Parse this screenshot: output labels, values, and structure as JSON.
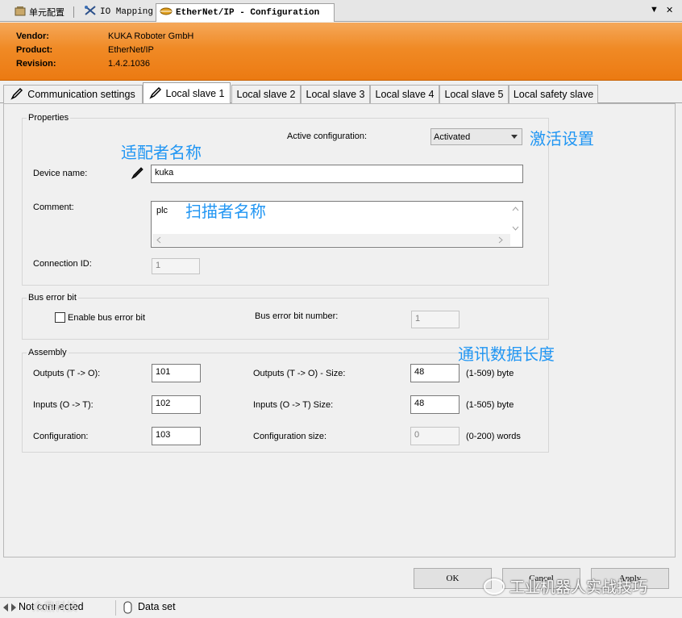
{
  "doc_tabs": [
    {
      "label": "单元配置",
      "icon": "device-config-icon"
    },
    {
      "label": "IO Mapping",
      "icon": "io-mapping-icon"
    },
    {
      "label": "EtherNet/IP - Configuration",
      "icon": "ethernet-ip-icon",
      "active": true
    }
  ],
  "doc_tab_controls": {
    "dropdown": "▼",
    "close": "✕"
  },
  "header": {
    "vendor_label": "Vendor:",
    "vendor_value": "KUKA Roboter GmbH",
    "product_label": "Product:",
    "product_value": "EtherNet/IP",
    "revision_label": "Revision:",
    "revision_value": "1.4.2.1036",
    "color": "#f08a25"
  },
  "sub_tabs": [
    {
      "label": "Communication settings",
      "icon": "pencil-icon"
    },
    {
      "label": "Local slave 1",
      "icon": "pencil-icon",
      "active": true
    },
    {
      "label": "Local slave 2"
    },
    {
      "label": "Local slave 3"
    },
    {
      "label": "Local slave 4"
    },
    {
      "label": "Local slave 5"
    },
    {
      "label": "Local safety slave"
    }
  ],
  "properties": {
    "title": "Properties",
    "active_config_label": "Active configuration:",
    "active_config_value": "Activated",
    "device_name_label": "Device name:",
    "device_name_value": "kuka",
    "comment_label": "Comment:",
    "comment_value": "plc",
    "connection_id_label": "Connection ID:",
    "connection_id_value": "1"
  },
  "bus_error": {
    "title": "Bus error bit",
    "enable_label": "Enable bus error bit",
    "enable_checked": false,
    "number_label": "Bus error bit number:",
    "number_value": "1"
  },
  "assembly": {
    "title": "Assembly",
    "outputs_label": "Outputs (T -> O):",
    "outputs_value": "101",
    "inputs_label": "Inputs (O -> T):",
    "inputs_value": "102",
    "config_label": "Configuration:",
    "config_value": "103",
    "outputs_size_label": "Outputs (T -> O) - Size:",
    "outputs_size_value": "48",
    "outputs_size_range": "(1-509) byte",
    "inputs_size_label": "Inputs (O -> T) Size:",
    "inputs_size_value": "48",
    "inputs_size_range": "(1-505) byte",
    "config_size_label": "Configuration size:",
    "config_size_value": "0",
    "config_size_range": "(0-200) words"
  },
  "annotations": {
    "adapter_name": "适配者名称",
    "activate": "激活设置",
    "scanner_name": "扫描者名称",
    "data_length": "通讯数据长度",
    "color": "#2196f3"
  },
  "buttons": {
    "ok": "OK",
    "cancel": "Cancel",
    "apply": "Apply"
  },
  "status": {
    "connection": "Not connected",
    "dataset": "Data set",
    "overlay": "众鼎科技"
  },
  "watermark": "工业机器人实战技巧"
}
